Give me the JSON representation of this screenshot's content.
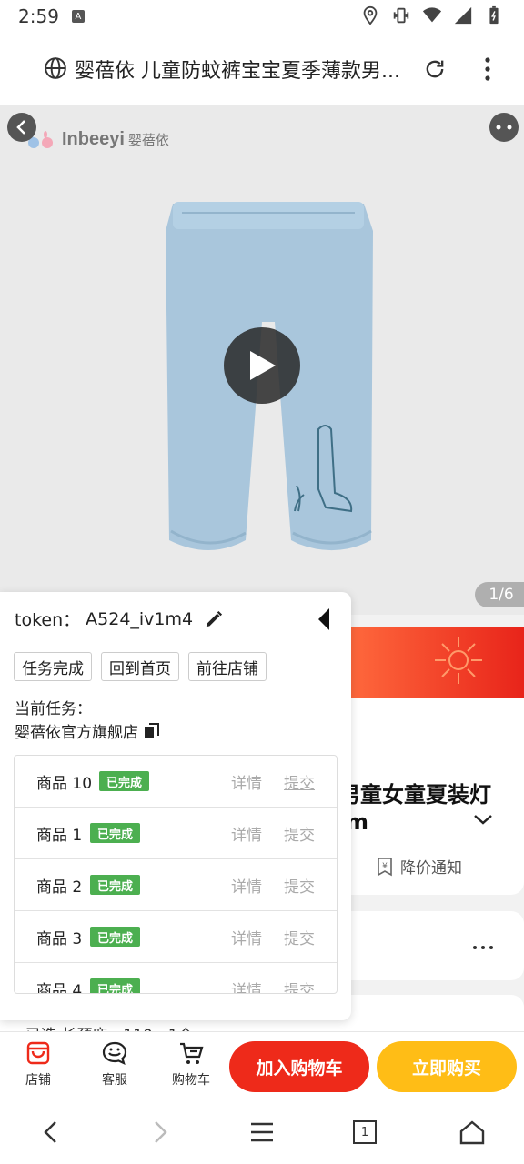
{
  "status_bar": {
    "time": "2:59",
    "a_icon": "A"
  },
  "address_bar": {
    "title": "婴蓓依 儿童防蚊裤宝宝夏季薄款男..."
  },
  "hero": {
    "brand_name": "Inbeeyi",
    "brand_cn": "婴蓓依",
    "image_counter": "1/6"
  },
  "product": {
    "title_line1": "男童女童夏装灯",
    "title_line2": "m",
    "price_notify": "降价通知",
    "selected": "已选   长颈鹿，110，1个"
  },
  "panel": {
    "token_label": "token：",
    "token_value": "A524_iv1m4",
    "buttons": [
      "任务完成",
      "回到首页",
      "前往店铺"
    ],
    "current_task_label": "当前任务：",
    "current_shop": "婴蓓依官方旗舰店",
    "tasks": [
      {
        "name": "商品 10",
        "status": "已完成",
        "detail": "详情",
        "submit": "提交"
      },
      {
        "name": "商品 1",
        "status": "已完成",
        "detail": "详情",
        "submit": "提交"
      },
      {
        "name": "商品 2",
        "status": "已完成",
        "detail": "详情",
        "submit": "提交"
      },
      {
        "name": "商品 3",
        "status": "已完成",
        "detail": "详情",
        "submit": "提交"
      },
      {
        "name": "商品 4",
        "status": "已完成",
        "detail": "详情",
        "submit": "提交"
      }
    ]
  },
  "action_bar": {
    "shop": "店铺",
    "service": "客服",
    "cart": "购物车",
    "add_to_cart": "加入购物车",
    "buy_now": "立即购买"
  },
  "nav_bar": {
    "tabs_count": "1"
  },
  "colors": {
    "badge_green": "#4caf50",
    "cart_red": "#ee2a1a",
    "buy_yellow": "#ffbd16",
    "pants_blue": "#a9c6dc"
  }
}
